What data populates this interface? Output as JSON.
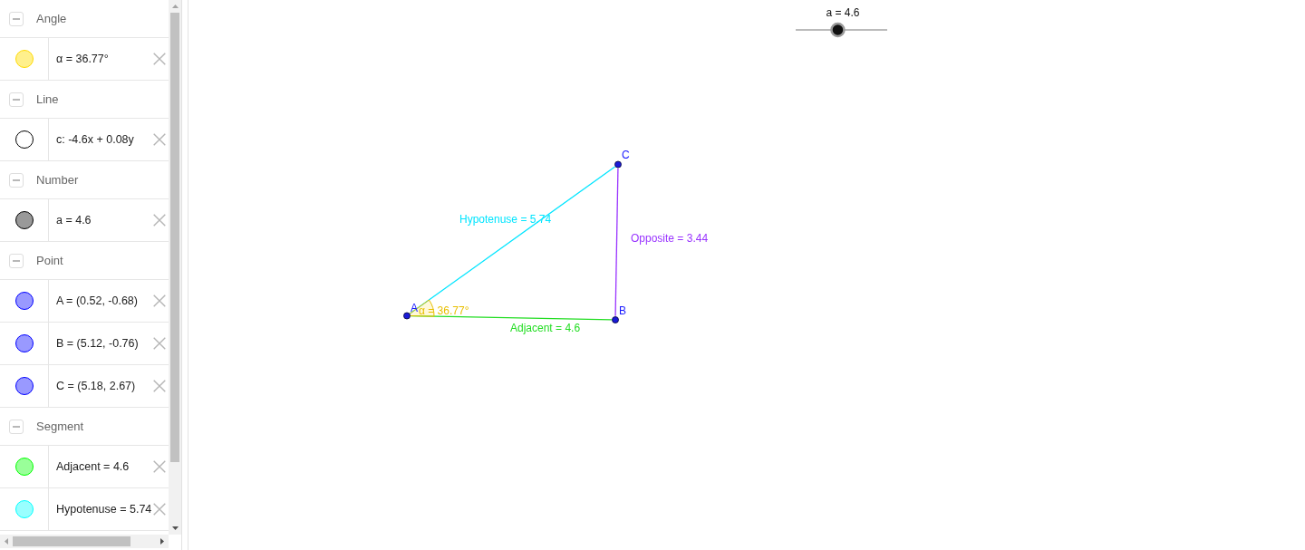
{
  "algebra_view": {
    "groups": [
      {
        "title": "Angle",
        "expanded": true,
        "items": [
          {
            "text": "α = 36.77°",
            "color": "#fff08c",
            "visible": true
          }
        ]
      },
      {
        "title": "Line",
        "expanded": true,
        "items": [
          {
            "text": "c: -4.6x + 0.08y",
            "color": "#000000",
            "visible": false
          }
        ]
      },
      {
        "title": "Number",
        "expanded": true,
        "items": [
          {
            "text": "a = 4.6",
            "color": "#999999",
            "visible": true
          }
        ]
      },
      {
        "title": "Point",
        "expanded": true,
        "items": [
          {
            "text": "A = (0.52, -0.68)",
            "color": "#9999ff",
            "visible": true
          },
          {
            "text": "B = (5.12, -0.76)",
            "color": "#9999ff",
            "visible": true
          },
          {
            "text": "C = (5.18, 2.67)",
            "color": "#9999ff",
            "visible": true
          }
        ]
      },
      {
        "title": "Segment",
        "expanded": true,
        "items": [
          {
            "text": "Adjacent = 4.6",
            "color": "#99ff99",
            "visible": true
          },
          {
            "text": "Hypotenuse = 5.74",
            "color": "#99ffff",
            "visible": true
          }
        ]
      }
    ]
  },
  "graphics_view": {
    "slider": {
      "label": "a = 4.6",
      "level": 0.46
    },
    "segments": [
      {
        "label": "Hypotenuse = 5.74",
        "color": "#00e5ff"
      },
      {
        "label": "Opposite = 3.44",
        "color": "#9933ff"
      },
      {
        "label": "Adjacent = 4.6",
        "color": "#22dd22"
      }
    ],
    "angle": {
      "label": "α = 36.77°"
    },
    "points": [
      {
        "label": "A"
      },
      {
        "label": "B"
      },
      {
        "label": "C"
      }
    ]
  }
}
